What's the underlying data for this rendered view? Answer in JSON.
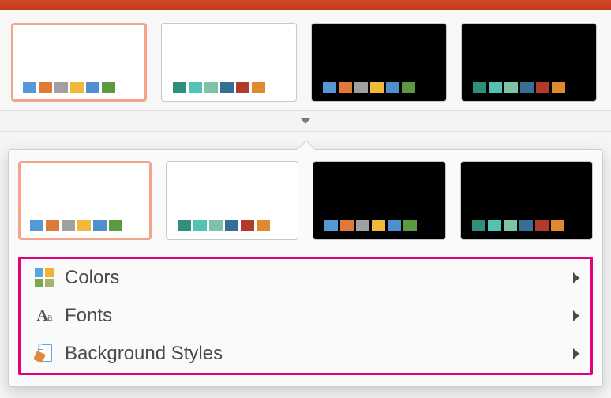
{
  "variants_top": [
    {
      "bg": "light",
      "selected": true,
      "swatches": [
        "#5598d6",
        "#e07a3b",
        "#a0a0a0",
        "#f1b93a",
        "#4f8fcf",
        "#5b9a3e"
      ]
    },
    {
      "bg": "light",
      "selected": false,
      "swatches": [
        "#2f8f7a",
        "#54c2b2",
        "#7ec2a8",
        "#366f96",
        "#b23a2a",
        "#e08a2f"
      ]
    },
    {
      "bg": "dark",
      "selected": false,
      "swatches": [
        "#5598d6",
        "#e07a3b",
        "#a0a0a0",
        "#f1b93a",
        "#4f8fcf",
        "#5b9a3e"
      ]
    },
    {
      "bg": "dark",
      "selected": false,
      "swatches": [
        "#2f8f7a",
        "#54c2b2",
        "#7ec2a8",
        "#366f96",
        "#b23a2a",
        "#e08a2f"
      ]
    }
  ],
  "variants_pop": [
    {
      "bg": "light",
      "selected": true,
      "swatches": [
        "#5598d6",
        "#e07a3b",
        "#a0a0a0",
        "#f1b93a",
        "#4f8fcf",
        "#5b9a3e"
      ]
    },
    {
      "bg": "light",
      "selected": false,
      "swatches": [
        "#2f8f7a",
        "#54c2b2",
        "#7ec2a8",
        "#366f96",
        "#b23a2a",
        "#e08a2f"
      ]
    },
    {
      "bg": "dark",
      "selected": false,
      "swatches": [
        "#5598d6",
        "#e07a3b",
        "#a0a0a0",
        "#f1b93a",
        "#4f8fcf",
        "#5b9a3e"
      ]
    },
    {
      "bg": "dark",
      "selected": false,
      "swatches": [
        "#2f8f7a",
        "#54c2b2",
        "#7ec2a8",
        "#366f96",
        "#b23a2a",
        "#e08a2f"
      ]
    }
  ],
  "menu": {
    "colors": "Colors",
    "fonts": "Fonts",
    "background_styles": "Background Styles"
  }
}
